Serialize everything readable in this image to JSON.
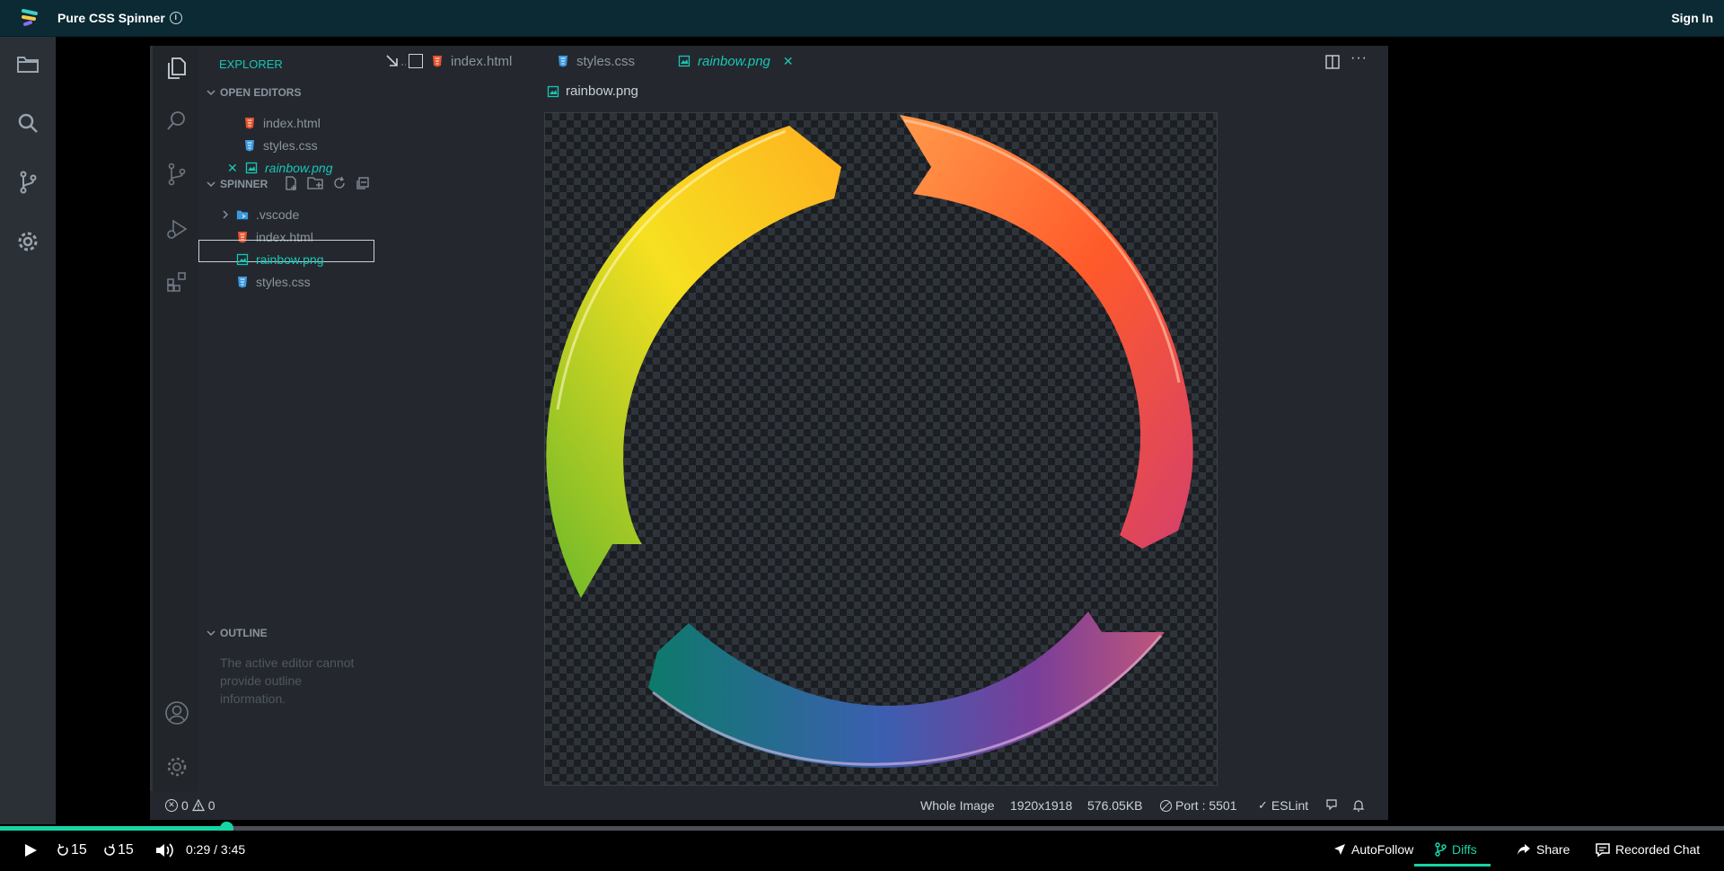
{
  "app": {
    "title": "Pure CSS Spinner",
    "sign_in": "Sign In"
  },
  "explorer": {
    "title": "EXPLORER",
    "open_editors": {
      "label": "OPEN EDITORS",
      "items": [
        {
          "name": "index.html",
          "icon": "html-file-icon"
        },
        {
          "name": "styles.css",
          "icon": "css-file-icon"
        },
        {
          "name": "rainbow.png",
          "icon": "image-file-icon",
          "active": true
        }
      ]
    },
    "project": {
      "label": "SPINNER",
      "items": [
        {
          "name": ".vscode",
          "icon": "folder-icon"
        },
        {
          "name": "index.html",
          "icon": "html-file-icon"
        },
        {
          "name": "rainbow.png",
          "icon": "image-file-icon",
          "selected": true
        },
        {
          "name": "styles.css",
          "icon": "css-file-icon"
        }
      ]
    },
    "outline": {
      "label": "OUTLINE",
      "message": "The active editor cannot provide outline information."
    }
  },
  "tabs": [
    {
      "label": "index.html"
    },
    {
      "label": "styles.css"
    },
    {
      "label": "rainbow.png",
      "active": true
    }
  ],
  "breadcrumb": "rainbow.png",
  "status": {
    "errors": "0",
    "warnings": "0",
    "view": "Whole Image",
    "dimensions": "1920x1918",
    "size": "576.05KB",
    "port": "Port : 5501",
    "eslint": "ESLint"
  },
  "player": {
    "rewind": "15",
    "forward": "15",
    "time": "0:29 / 3:45",
    "progress": 0.131,
    "autofollow": "AutoFollow",
    "diffs": "Diffs",
    "share": "Share",
    "recorded_chat": "Recorded Chat"
  },
  "colors": {
    "accent": "#19c5b5",
    "progress": "#17d4a5",
    "html": "#e5532d",
    "css": "#3b9ae1"
  }
}
